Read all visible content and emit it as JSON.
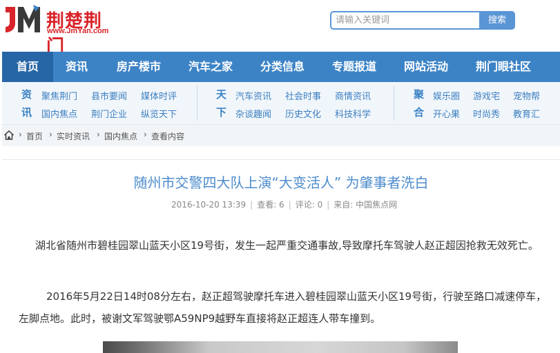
{
  "header": {
    "logo_mark": "JM",
    "logo_name": "荆楚荆门",
    "logo_url": "www.JmYan.com",
    "search_placeholder": "请输入关键词",
    "search_button": "搜索"
  },
  "nav": {
    "items": [
      "首页",
      "资讯",
      "房产楼市",
      "汽车之家",
      "分类信息",
      "专题报道",
      "网站活动",
      "荆门眼社区"
    ],
    "active_index": 0,
    "color": "#3c83c6",
    "active_color": "#2766a6"
  },
  "subnav": {
    "groups": [
      {
        "title": [
          "资",
          "讯"
        ],
        "row1": [
          "聚焦荆门",
          "县市要闻",
          "媒体时评"
        ],
        "row2": [
          "国内焦点",
          "荆门企业",
          "纵览天下"
        ]
      },
      {
        "title": [
          "天",
          "下"
        ],
        "row1": [
          "汽车资讯",
          "社会时事",
          "商情资讯"
        ],
        "row2": [
          "杂谈趣闻",
          "历史文化",
          "科技科学"
        ]
      },
      {
        "title": [
          "聚",
          "合"
        ],
        "row1": [
          "娱乐圈",
          "游戏宅",
          "宠物帮"
        ],
        "row2": [
          "开心果",
          "时尚秀",
          "教育汇"
        ]
      }
    ]
  },
  "breadcrumb": {
    "home_icon": "home-icon",
    "items": [
      "首页",
      "实时资讯",
      "国内焦点",
      "查看内容"
    ],
    "separator": "›"
  },
  "article": {
    "title": "随州市交警四大队上演“大变活人” 为肇事者洗白",
    "meta": {
      "datetime": "2016-10-20 13:39",
      "views": "查看: 6",
      "comments": "评论: 0",
      "source": "来自: 中国焦点网"
    },
    "paragraphs": [
      "湖北省随州市碧桂园翠山蓝天小区19号街，发生一起严重交通事故,导致摩托车驾驶人赵正超因抢救无效死亡。",
      "2016年5月22日14时08分左右，赵正超驾驶摩托车进入碧桂园翠山蓝天小区19号街，行驶至路口减速停车，左脚点地。此时，被谢文军驾驶鄂A59NP9越野车直接将赵正超连人带车撞到。"
    ]
  }
}
